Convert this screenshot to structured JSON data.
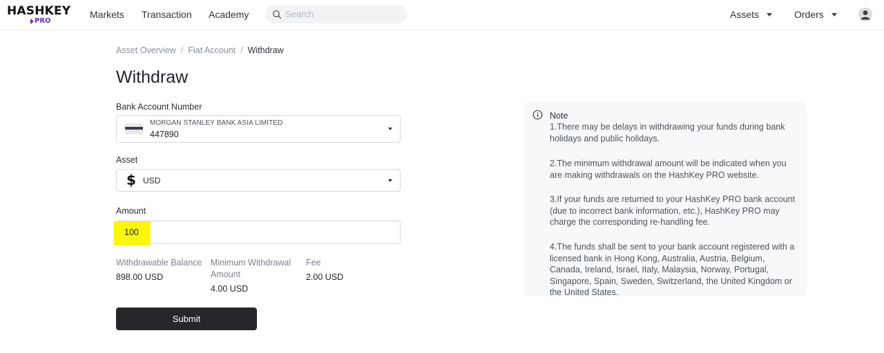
{
  "brand": {
    "word": "HASHKEY",
    "sub": "PRO"
  },
  "nav": {
    "links": [
      "Markets",
      "Transaction",
      "Academy"
    ],
    "search_placeholder": "Search",
    "right": [
      "Assets",
      "Orders"
    ]
  },
  "breadcrumb": [
    "Asset Overview",
    "Fiat Account",
    "Withdraw"
  ],
  "page_title": "Withdraw",
  "form": {
    "bank_label": "Bank Account Number",
    "bank_name": "MORGAN STANLEY BANK ASIA LIMITED",
    "bank_number": "447890",
    "asset_label": "Asset",
    "asset_value": "USD",
    "amount_label": "Amount",
    "amount_value": "100",
    "highlight_color": "#fbf70f",
    "info": [
      {
        "label": "Withdrawable Balance",
        "value": "898.00 USD"
      },
      {
        "label": "Minimum Withdrawal Amount",
        "value": "4.00 USD"
      },
      {
        "label": "Fee",
        "value": "2.00 USD"
      }
    ],
    "submit_label": "Submit"
  },
  "note": {
    "title": "Note",
    "items": [
      "1.There may be delays in withdrawing your funds during bank holidays and public holidays.",
      "2.The minimum withdrawal amount will be indicated when you are making withdrawals on the HashKey PRO website.",
      "3.If your funds are returned to your HashKey PRO bank account (due to incorrect bank information, etc.), HashKey PRO may charge the corresponding re-handling fee.",
      "4.The funds shall be sent to your bank account registered with a licensed bank in Hong Kong, Australia, Austria, Belgium, Canada, Ireland, Israel, Italy, Malaysia, Norway, Portugal, Singapore, Spain, Sweden, Switzerland, the United Kingdom or the United States."
    ]
  },
  "icons": {
    "search": "search-icon",
    "caret": "chevron-down-icon",
    "avatar": "user-avatar-icon",
    "card": "bank-card-icon",
    "currency": "dollar-icon",
    "note": "info-icon"
  },
  "colors": {
    "accent": "#6b2cc5",
    "button": "#25272b"
  }
}
